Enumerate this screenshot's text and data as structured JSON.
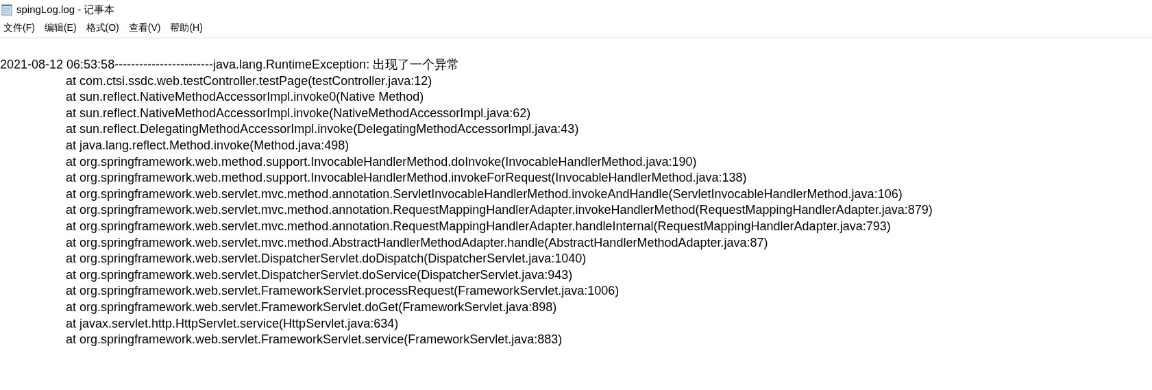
{
  "window": {
    "title": "spingLog.log - 记事本"
  },
  "menu": [
    {
      "label": "文件(F)"
    },
    {
      "label": "编辑(E)"
    },
    {
      "label": "格式(O)"
    },
    {
      "label": "查看(V)"
    },
    {
      "label": "帮助(H)"
    }
  ],
  "lines": [
    {
      "kind": "head",
      "text": "2021-08-12 06:53:58------------------------java.lang.RuntimeException: 出现了一个异常"
    },
    {
      "kind": "frame",
      "text": "at com.ctsi.ssdc.web.testController.testPage(testController.java:12)"
    },
    {
      "kind": "frame",
      "text": "at sun.reflect.NativeMethodAccessorImpl.invoke0(Native Method)"
    },
    {
      "kind": "frame",
      "text": "at sun.reflect.NativeMethodAccessorImpl.invoke(NativeMethodAccessorImpl.java:62)"
    },
    {
      "kind": "frame",
      "text": "at sun.reflect.DelegatingMethodAccessorImpl.invoke(DelegatingMethodAccessorImpl.java:43)"
    },
    {
      "kind": "frame",
      "text": "at java.lang.reflect.Method.invoke(Method.java:498)"
    },
    {
      "kind": "frame",
      "text": "at org.springframework.web.method.support.InvocableHandlerMethod.doInvoke(InvocableHandlerMethod.java:190)"
    },
    {
      "kind": "frame",
      "text": "at org.springframework.web.method.support.InvocableHandlerMethod.invokeForRequest(InvocableHandlerMethod.java:138)"
    },
    {
      "kind": "frame",
      "text": "at org.springframework.web.servlet.mvc.method.annotation.ServletInvocableHandlerMethod.invokeAndHandle(ServletInvocableHandlerMethod.java:106)"
    },
    {
      "kind": "frame",
      "text": "at org.springframework.web.servlet.mvc.method.annotation.RequestMappingHandlerAdapter.invokeHandlerMethod(RequestMappingHandlerAdapter.java:879)"
    },
    {
      "kind": "frame",
      "text": "at org.springframework.web.servlet.mvc.method.annotation.RequestMappingHandlerAdapter.handleInternal(RequestMappingHandlerAdapter.java:793)"
    },
    {
      "kind": "frame",
      "text": "at org.springframework.web.servlet.mvc.method.AbstractHandlerMethodAdapter.handle(AbstractHandlerMethodAdapter.java:87)"
    },
    {
      "kind": "frame",
      "text": "at org.springframework.web.servlet.DispatcherServlet.doDispatch(DispatcherServlet.java:1040)"
    },
    {
      "kind": "frame",
      "text": "at org.springframework.web.servlet.DispatcherServlet.doService(DispatcherServlet.java:943)"
    },
    {
      "kind": "frame",
      "text": "at org.springframework.web.servlet.FrameworkServlet.processRequest(FrameworkServlet.java:1006)"
    },
    {
      "kind": "frame",
      "text": "at org.springframework.web.servlet.FrameworkServlet.doGet(FrameworkServlet.java:898)"
    },
    {
      "kind": "frame",
      "text": "at javax.servlet.http.HttpServlet.service(HttpServlet.java:634)"
    },
    {
      "kind": "frame",
      "text": "at org.springframework.web.servlet.FrameworkServlet.service(FrameworkServlet.java:883)"
    }
  ]
}
